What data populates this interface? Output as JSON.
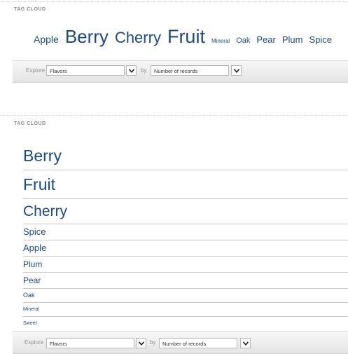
{
  "top": {
    "section_title": "TAG CLOUD",
    "tags": [
      "Apple",
      "Berry",
      "Cherry",
      "Fruit",
      "Mineral",
      "Oak",
      "Pear",
      "Plum",
      "Spice"
    ],
    "explore": {
      "explore_label": "Explore",
      "dimension_value": "Flavors",
      "by_label": "by",
      "metric_value": "Number of records"
    }
  },
  "bottom": {
    "section_title": "TAG CLOUD",
    "tags": [
      "Berry",
      "Fruit",
      "Cherry",
      "Spice",
      "Apple",
      "Plum",
      "Pear",
      "Oak",
      "Mineral",
      "Sweet"
    ],
    "explore": {
      "explore_label": "Explore",
      "dimension_value": "Flavors",
      "by_label": "by",
      "metric_value": "Number of records"
    }
  },
  "colors": {
    "tag": "#1b4a86",
    "title": "#8a8a8a"
  },
  "icons": {
    "dropdown": "chevron-down-icon"
  }
}
